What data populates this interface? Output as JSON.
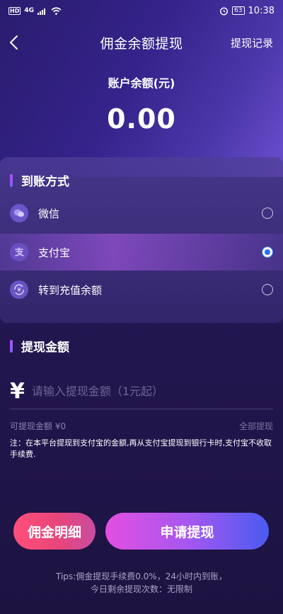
{
  "status_bar": {
    "hd": "HD",
    "signal": "4G",
    "battery": "63",
    "time": "10:38"
  },
  "nav": {
    "title": "佣金余额提现",
    "right_label": "提现记录"
  },
  "balance": {
    "label": "账户余额(元)",
    "value": "0.00"
  },
  "payment": {
    "section_title": "到账方式",
    "options": [
      {
        "label": "微信",
        "icon": "wechat-icon",
        "selected": false
      },
      {
        "label": "支付宝",
        "icon": "alipay-icon",
        "selected": true
      },
      {
        "label": "转到充值余额",
        "icon": "recharge-icon",
        "selected": false
      }
    ]
  },
  "amount": {
    "section_title": "提现金额",
    "currency_symbol": "¥",
    "placeholder": "请输入提现金额（1元起）",
    "value": "",
    "available_label": "可提现金额 ¥0",
    "all_label": "全部提现",
    "note": "注：在本平台提现到支付宝的金额,再从支付宝提现到银行卡时,支付宝不收取手续费."
  },
  "buttons": {
    "detail": "佣金明细",
    "apply": "申请提现"
  },
  "tips": {
    "line1": "Tips:佣金提现手续费0.0%，24小时内到账，",
    "line2": "今日剩余提现次数：无限制"
  },
  "colors": {
    "selected_radio": "#2f6cff",
    "section_bar": "#c04bff",
    "detail_button": "#ff4f7a",
    "apply_button_start": "#e24fe0",
    "apply_button_end": "#4a5bf0"
  }
}
